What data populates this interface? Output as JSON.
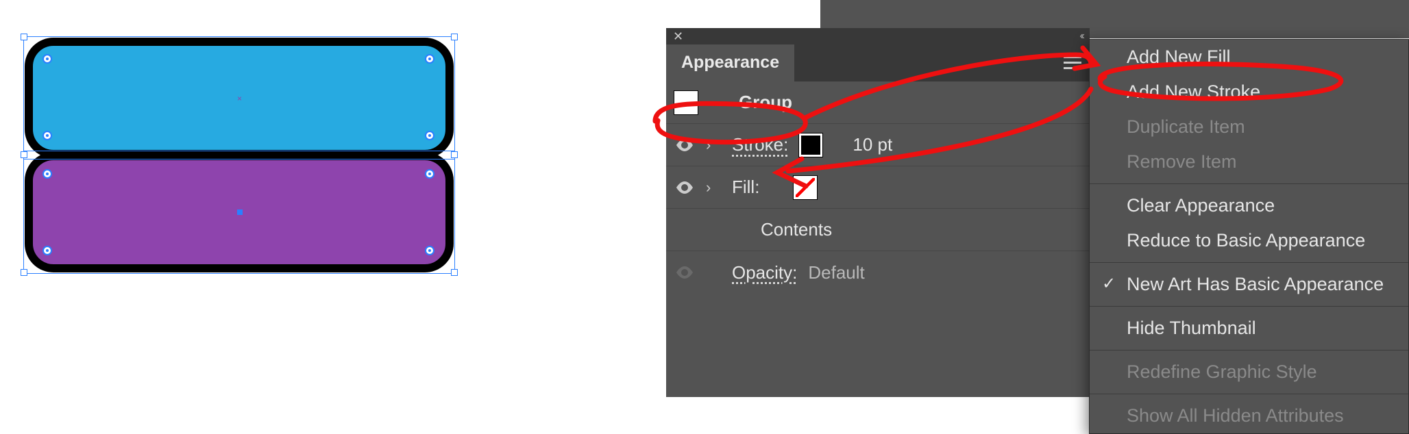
{
  "panel": {
    "title": "Appearance",
    "group_label": "Group",
    "rows": {
      "stroke_label": "Stroke:",
      "stroke_value": "10 pt",
      "fill_label": "Fill:",
      "contents_label": "Contents",
      "opacity_label": "Opacity:",
      "opacity_value": "Default"
    }
  },
  "menu": {
    "add_new_fill": "Add New Fill",
    "add_new_stroke": "Add New Stroke",
    "duplicate_item": "Duplicate Item",
    "remove_item": "Remove Item",
    "clear_appearance": "Clear Appearance",
    "reduce": "Reduce to Basic Appearance",
    "new_art": "New Art Has Basic Appearance",
    "hide_thumb": "Hide Thumbnail",
    "redefine": "Redefine Graphic Style",
    "show_hidden": "Show All Hidden Attributes"
  },
  "artwork": {
    "top_fill": "#27aae1",
    "bottom_fill": "#8e44ad",
    "stroke": "#000000",
    "stroke_weight": "10 pt"
  }
}
